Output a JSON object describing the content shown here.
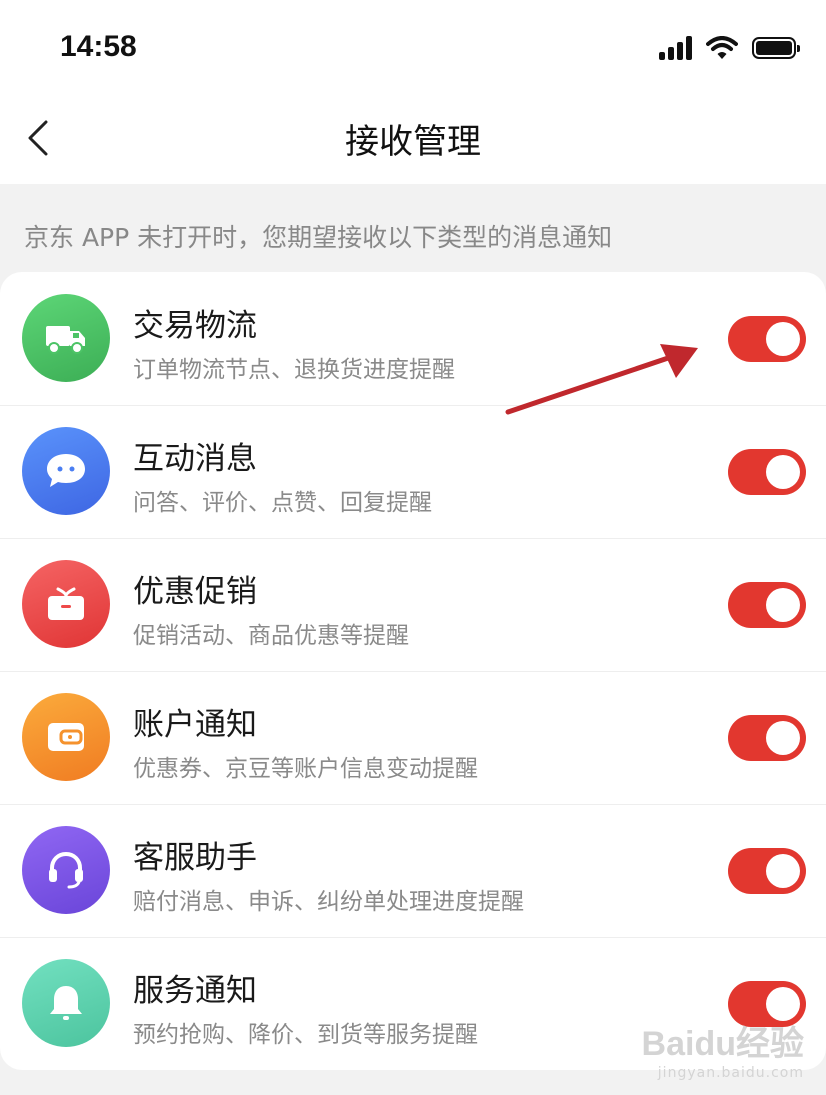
{
  "status_bar": {
    "time": "14:58"
  },
  "nav": {
    "title": "接收管理"
  },
  "hint": "京东 APP 未打开时，您期望接收以下类型的消息通知",
  "items": [
    {
      "title": "交易物流",
      "subtitle": "订单物流节点、退换货进度提醒",
      "icon": "truck-icon",
      "color": "#4cc466",
      "enabled": true
    },
    {
      "title": "互动消息",
      "subtitle": "问答、评价、点赞、回复提醒",
      "icon": "chat-bubble-icon",
      "color": "#4a7ef2",
      "enabled": true
    },
    {
      "title": "优惠促销",
      "subtitle": "促销活动、商品优惠等提醒",
      "icon": "gift-icon",
      "color": "#ee4a4a",
      "enabled": true
    },
    {
      "title": "账户通知",
      "subtitle": "优惠券、京豆等账户信息变动提醒",
      "icon": "wallet-icon",
      "color": "#f5922d",
      "enabled": true
    },
    {
      "title": "客服助手",
      "subtitle": "赔付消息、申诉、纠纷单处理进度提醒",
      "icon": "headset-icon",
      "color": "#7b56e6",
      "enabled": true
    },
    {
      "title": "服务通知",
      "subtitle": "预约抢购、降价、到货等服务提醒",
      "icon": "bell-icon",
      "color": "#5fd3b0",
      "enabled": true
    }
  ],
  "toggle_color": "#e2372f",
  "watermark": {
    "main": "Baidu经验",
    "sub": "jingyan.baidu.com"
  }
}
